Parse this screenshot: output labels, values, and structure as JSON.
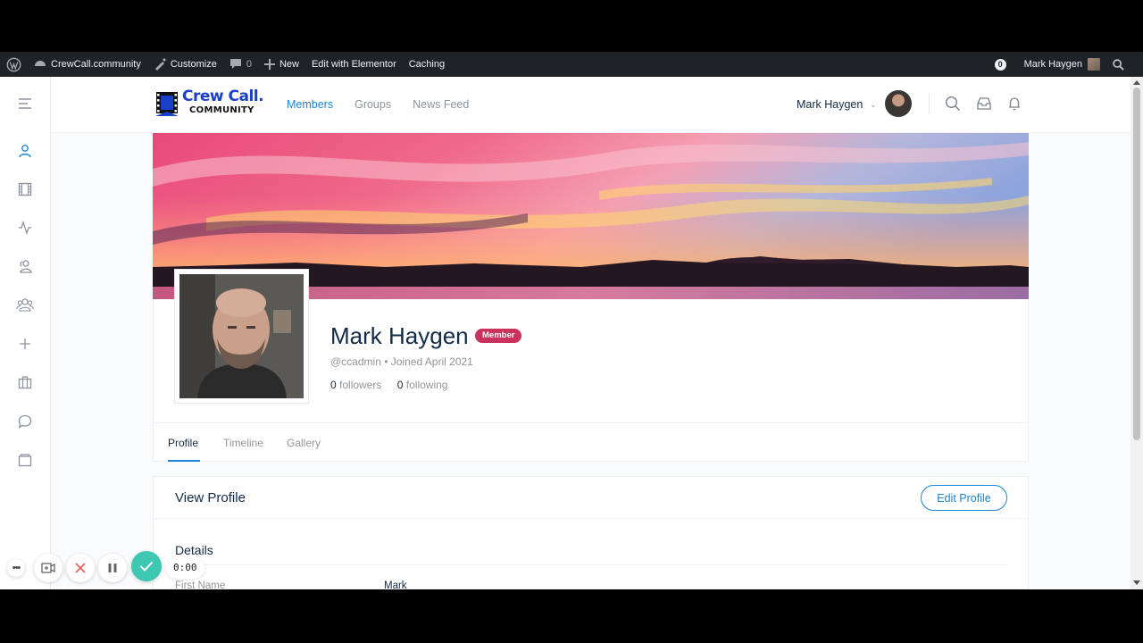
{
  "adminbar": {
    "site_name": "CrewCall.community",
    "customize": "Customize",
    "comments_count": "0",
    "new_label": "New",
    "elementor": "Edit with Elementor",
    "caching": "Caching",
    "notifications_count": "0",
    "user_name": "Mark Haygen"
  },
  "header": {
    "logo_line1": "Crew Call.",
    "logo_line2": "COMMUNITY",
    "nav": [
      "Members",
      "Groups",
      "News Feed"
    ],
    "active_nav": "Members",
    "user_name": "Mark Haygen"
  },
  "sidebar": {
    "icons": [
      "menu-icon",
      "user-icon",
      "film-icon",
      "activity-icon",
      "members-icon",
      "groups-icon",
      "plus-icon",
      "briefcase-icon",
      "chat-icon",
      "folder-icon"
    ],
    "active": "user-icon"
  },
  "profile": {
    "name": "Mark Haygen",
    "badge": "Member",
    "handle": "@ccadmin",
    "joined": "Joined April 2021",
    "followers_count": "0",
    "followers_label": "followers",
    "following_count": "0",
    "following_label": "following"
  },
  "tabs": [
    "Profile",
    "Timeline",
    "Gallery"
  ],
  "active_tab": "Profile",
  "view_profile": {
    "title": "View Profile",
    "edit_button": "Edit Profile",
    "section": "Details",
    "fields": [
      {
        "label": "First Name",
        "value": "Mark"
      }
    ]
  },
  "recorder": {
    "time": "0:00"
  },
  "colors": {
    "accent": "#1e85d9",
    "badge": "#c8325c",
    "adminbar": "#1d2327",
    "text_dark": "#122b46"
  }
}
